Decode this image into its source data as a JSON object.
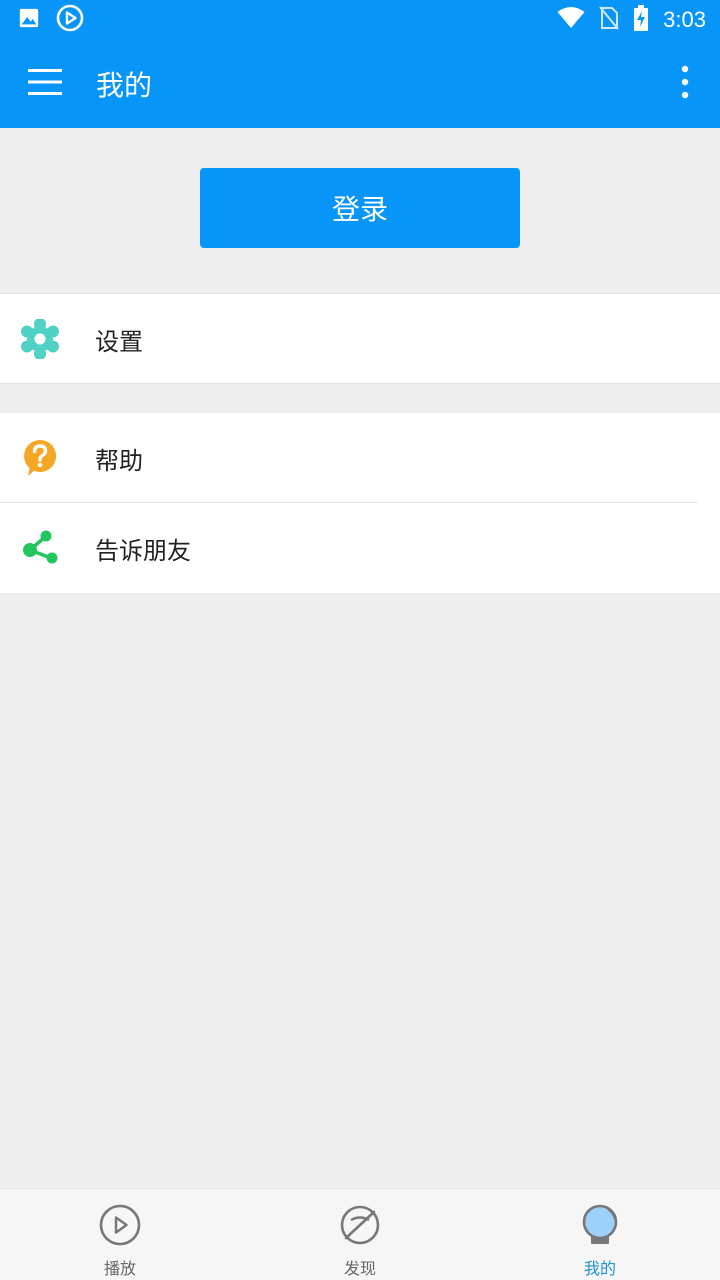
{
  "status_bar": {
    "time": "3:03",
    "icons": [
      "image-icon",
      "play-circle-icon",
      "wifi-icon",
      "no-sim-icon",
      "battery-charging-icon"
    ]
  },
  "app_bar": {
    "title": "我的",
    "icons": [
      "menu-icon",
      "more-vert-icon"
    ]
  },
  "login": {
    "label": "登录"
  },
  "list": {
    "settings": {
      "label": "设置",
      "icon": "gear-icon",
      "color": "#4fd1c5"
    },
    "help": {
      "label": "帮助",
      "icon": "help-icon",
      "color": "#f5a623"
    },
    "share": {
      "label": "告诉朋友",
      "icon": "share-icon",
      "color": "#22c55e"
    }
  },
  "bottom_nav": {
    "items": [
      {
        "label": "播放",
        "icon": "play-circle-icon"
      },
      {
        "label": "发现",
        "icon": "discover-icon"
      },
      {
        "label": "我的",
        "icon": "user-icon",
        "active": true
      }
    ]
  },
  "colors": {
    "primary": "#0795fa",
    "background": "#eeeeee",
    "active_nav": "#1e90d8"
  }
}
